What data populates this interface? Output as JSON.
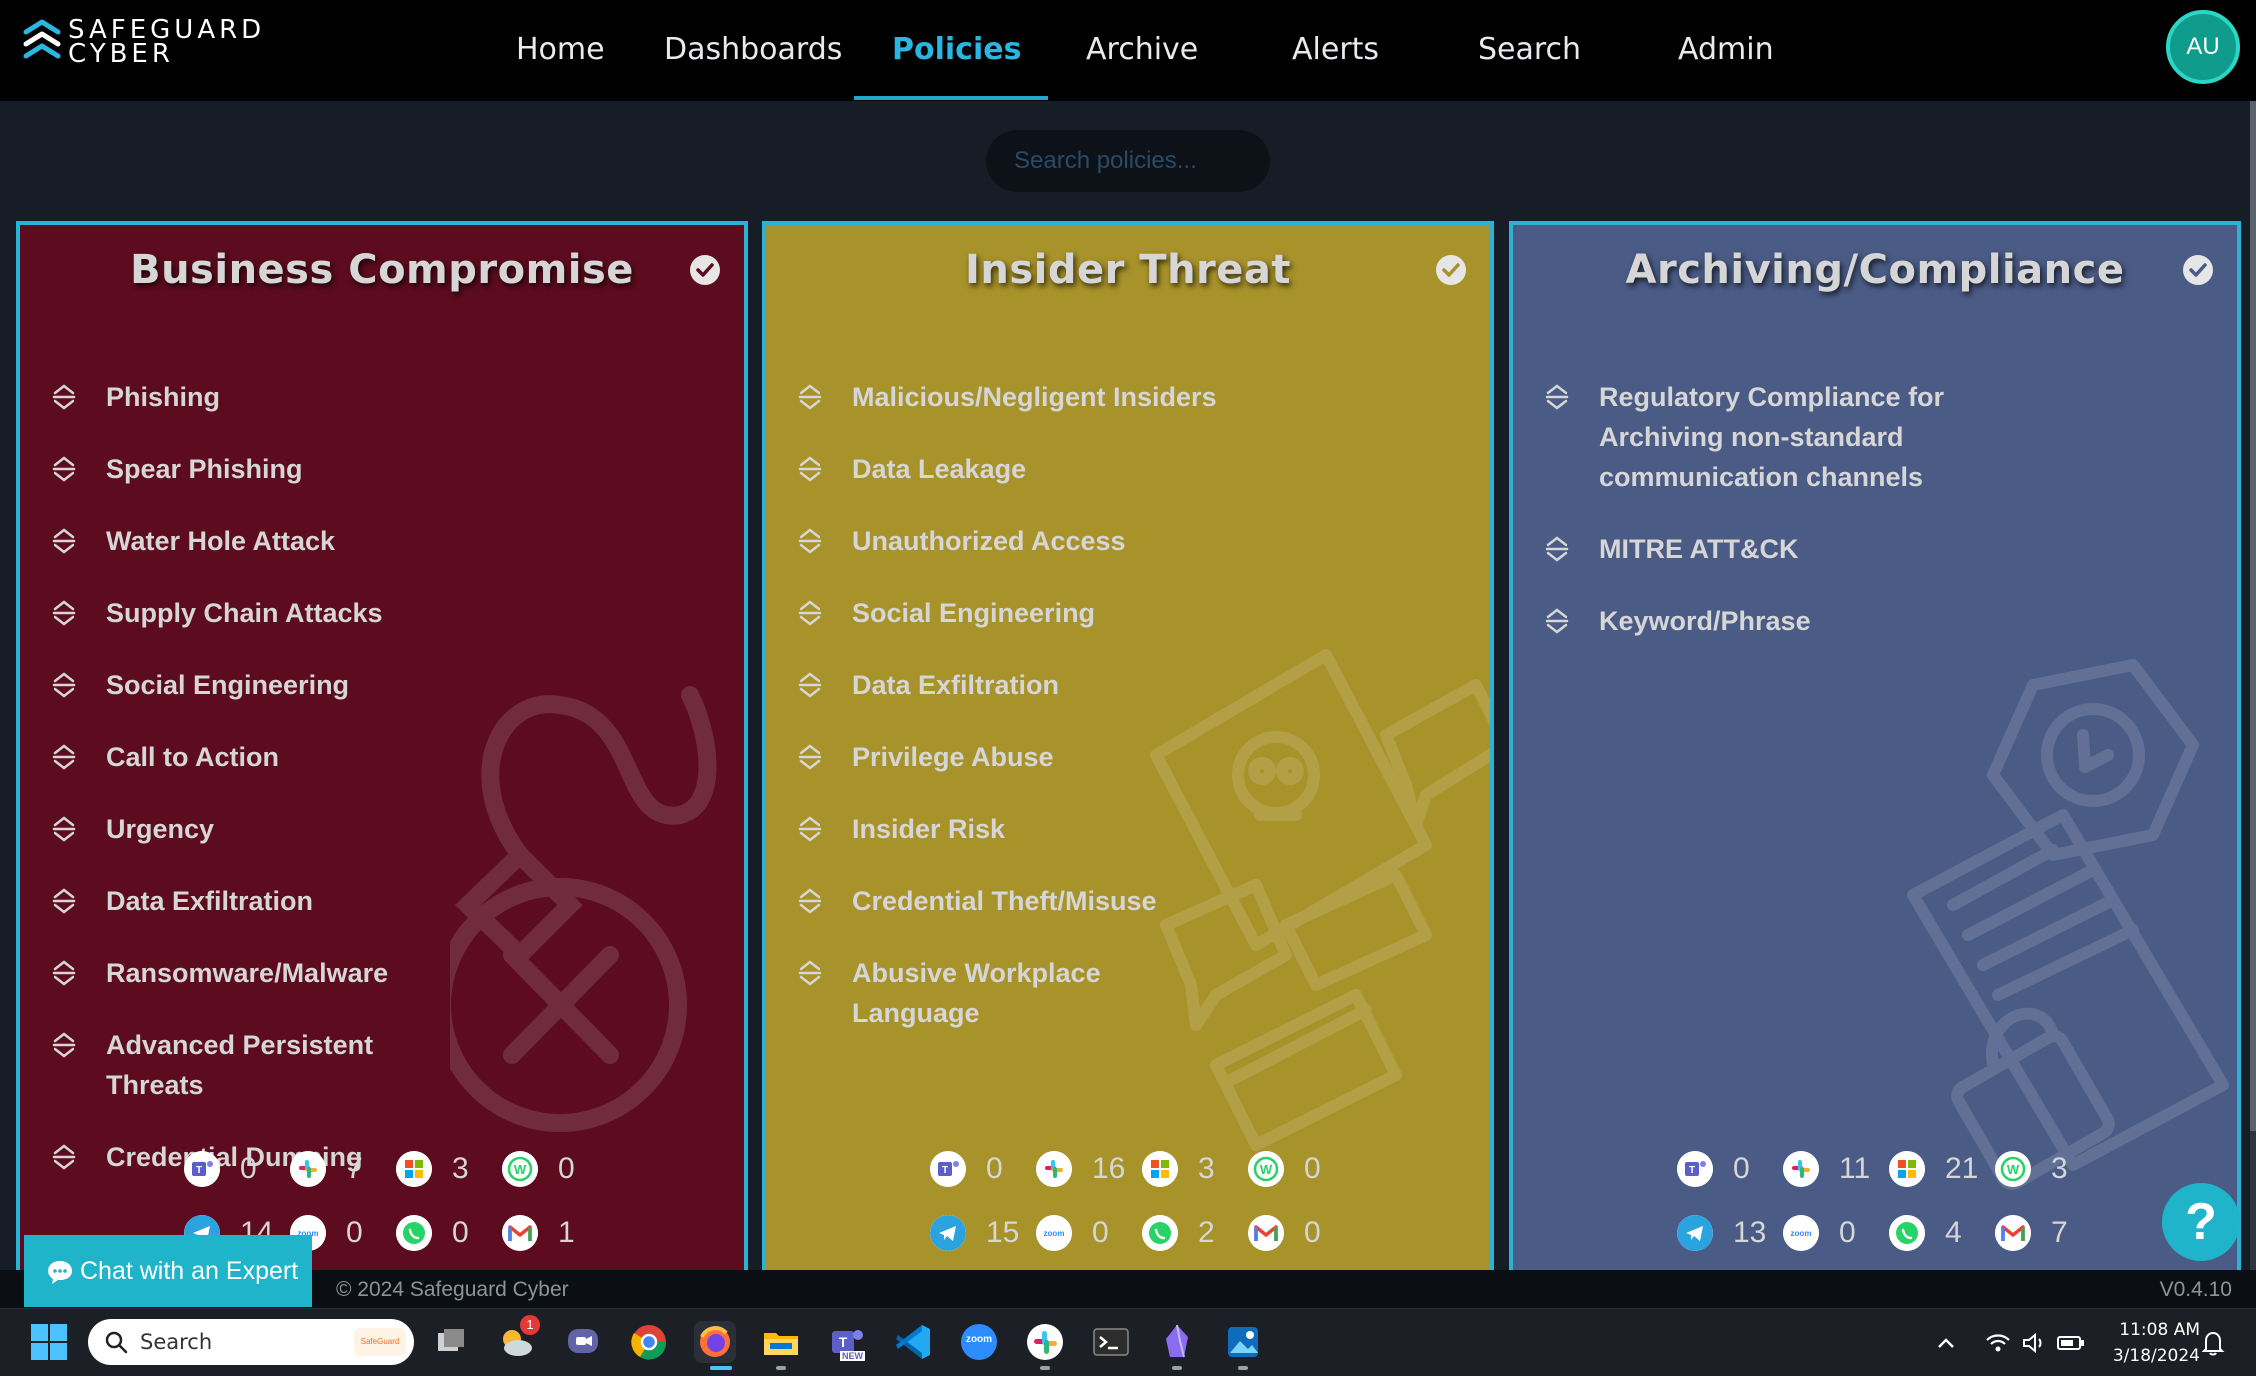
{
  "app": {
    "logo_line1": "SAFEGUARD",
    "logo_line2": "CYBER",
    "brand_color": "#1fa8c9"
  },
  "nav": {
    "items": [
      {
        "label": "Home"
      },
      {
        "label": "Dashboards"
      },
      {
        "label": "Policies",
        "active": true
      },
      {
        "label": "Archive"
      },
      {
        "label": "Alerts"
      },
      {
        "label": "Search"
      },
      {
        "label": "Admin"
      }
    ],
    "avatar_initials": "AU"
  },
  "search": {
    "placeholder": "Search policies...",
    "value": ""
  },
  "cards": [
    {
      "title": "Business Compromise",
      "color": "#5c0c1e",
      "selected": true,
      "icon": "bomb-icon",
      "policies": [
        "Phishing",
        "Spear Phishing",
        "Water Hole Attack",
        "Supply Chain Attacks",
        "Social Engineering",
        "Call to Action",
        "Urgency",
        "Data Exfiltration",
        "Ransomware/Malware",
        "Advanced Persistent Threats",
        "Credential Dumping"
      ],
      "counts": {
        "teams": "0",
        "slack": "7",
        "microsoft": "3",
        "whatsapp_business": "0",
        "telegram": "14",
        "zoom": "0",
        "whatsapp": "0",
        "gmail": "1"
      }
    },
    {
      "title": "Insider Threat",
      "color": "#a8922a",
      "selected": true,
      "icon": "skull-chat-icon",
      "policies": [
        "Malicious/Negligent Insiders",
        "Data Leakage",
        "Unauthorized Access",
        "Social Engineering",
        "Data Exfiltration",
        "Privilege Abuse",
        "Insider Risk",
        "Credential Theft/Misuse",
        "Abusive Workplace Language"
      ],
      "counts": {
        "teams": "0",
        "slack": "16",
        "microsoft": "3",
        "whatsapp_business": "0",
        "telegram": "15",
        "zoom": "0",
        "whatsapp": "2",
        "gmail": "0"
      }
    },
    {
      "title": "Archiving/Compliance",
      "color": "#4a5b85",
      "selected": true,
      "icon": "archive-document-icon",
      "policies": [
        "Regulatory Compliance for Archiving non-standard communication channels",
        "MITRE ATT&CK",
        "Keyword/Phrase"
      ],
      "counts": {
        "teams": "0",
        "slack": "11",
        "microsoft": "21",
        "whatsapp_business": "3",
        "telegram": "13",
        "zoom": "0",
        "whatsapp": "4",
        "gmail": "7"
      }
    }
  ],
  "chat": {
    "label": "Chat with an Expert"
  },
  "footer": {
    "copyright": "© 2024 Safeguard Cyber",
    "version": "V0.4.10"
  },
  "help": {
    "label": "?"
  },
  "taskbar": {
    "search_label": "Search",
    "search_chip": "SafeGuard",
    "notification_badge": "1",
    "teams_badge": "NEW",
    "zoom_label": "zoom",
    "time": "11:08 AM",
    "date": "3/18/2024"
  }
}
